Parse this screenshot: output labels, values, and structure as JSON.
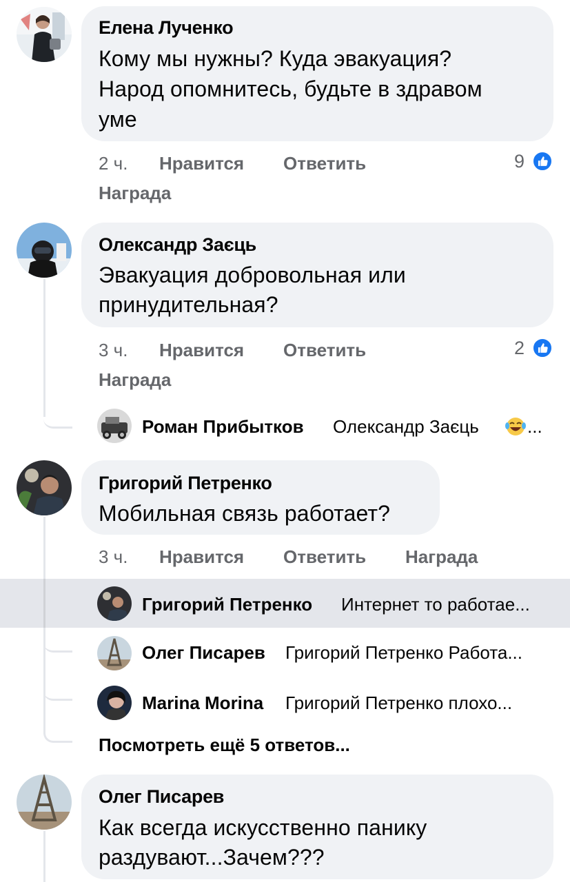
{
  "colors": {
    "accent": "#1877f2",
    "bubble": "#f0f2f5",
    "meta": "#65676b",
    "highlight": "#e4e6eb"
  },
  "comments": [
    {
      "author": "Елена Лученко",
      "lines": [
        "Кому мы нужны? Куда эвакуация?",
        "Народ опомнитесь, будьте в здравом",
        "уме"
      ],
      "time": "2 ч.",
      "like_label": "Нравится",
      "reply_label": "Ответить",
      "award_label": "Награда",
      "likes": "9",
      "like_icon": "thumbs-up-icon"
    },
    {
      "author": "Олександр Заєць",
      "lines": [
        "Эвакуация добровольная или",
        "принудительная?"
      ],
      "time": "3 ч.",
      "like_label": "Нравится",
      "reply_label": "Ответить",
      "award_label": "Награда",
      "likes": "2",
      "like_icon": "thumbs-up-icon",
      "replies": [
        {
          "author": "Роман Прибытков",
          "text": "Олександр Заєць",
          "emoji": "laughing-tears-emoji",
          "ellipsis": "..."
        }
      ]
    },
    {
      "author": "Григорий Петренко",
      "lines": [
        "Мобильная связь работает?"
      ],
      "time": "3 ч.",
      "like_label": "Нравится",
      "reply_label": "Ответить",
      "award_label": "Награда",
      "replies": [
        {
          "author": "Григорий Петренко",
          "text": "Интернет то работае..."
        },
        {
          "author": "Олег Писарев",
          "text": "Григорий Петренко Работа..."
        },
        {
          "author": "Marina Morina",
          "text": "Григорий Петренко плохо..."
        }
      ],
      "more_replies": "Посмотреть ещё 5 ответов..."
    },
    {
      "author": "Олег Писарев",
      "lines": [
        "Как всегда искусственно панику",
        "раздувают...Зачем???"
      ]
    }
  ]
}
